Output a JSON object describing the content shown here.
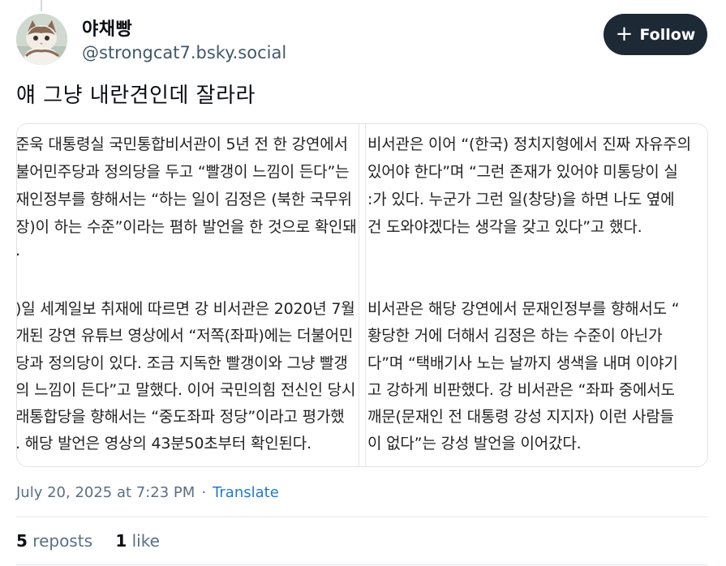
{
  "author": {
    "display_name": "야채빵",
    "handle": "@strongcat7.bsky.social"
  },
  "follow_button": {
    "icon": "plus-icon",
    "label": "Follow"
  },
  "post": {
    "text": "얘 그냥 내란견인데 잘라라"
  },
  "images": {
    "left_lines": [
      "준욱 대통령실 국민통합비서관이 5년 전 한 강연에서",
      "불어민주당과 정의당을 두고 “빨갱이 느낌이 든다”는",
      "재인정부를 향해서는 “하는 일이 김정은 (북한 국무위",
      "장)이 하는 수준”이라는 폄하 발언을 한 것으로 확인돼",
      ".",
      "",
      ")일 세계일보 취재에 따르면 강 비서관은 2020년 7월",
      "개된 강연 유튜브 영상에서 “저쪽(좌파)에는 더불어민",
      "당과 정의당이 있다. 조금 지독한 빨갱이와 그냥 빨갱",
      "의 느낌이 든다”고 말했다. 이어 국민의힘 전신인 당시",
      "래통합당을 향해서는 “중도좌파 정당”이라고 평가했",
      ". 해당 발언은 영상의 43분50초부터 확인된다."
    ],
    "right_lines": [
      "비서관은 이어 “(한국) 정치지형에서 진짜 자유주의",
      " 있어야 한다”며 “그런 존재가 있어야 미통당이 실",
      ":가 있다. 누군가 그런 일(창당)을 하면 나도 옆에",
      "건 도와야겠다는 생각을 갖고 있다”고 했다.",
      "",
      "",
      "비서관은 해당 강연에서 문재인정부를 향해서도 “",
      " 황당한 거에 더해서 김정은 하는 수준이 아닌가",
      "다”며 “택배기사 노는 날까지 생색을 내며 이야기",
      "고 강하게 비판했다. 강 비서관은 “좌파 중에서도",
      "깨문(문재인 전 대통령 강성 지지자) 이런 사람들",
      "이 없다”는 강성 발언을 이어갔다."
    ]
  },
  "meta": {
    "timestamp": "July 20, 2025 at 7:23 PM",
    "separator": "·",
    "translate_label": "Translate"
  },
  "stats": {
    "reposts_count": "5",
    "reposts_label": "reposts",
    "likes_count": "1",
    "likes_label": "like"
  }
}
